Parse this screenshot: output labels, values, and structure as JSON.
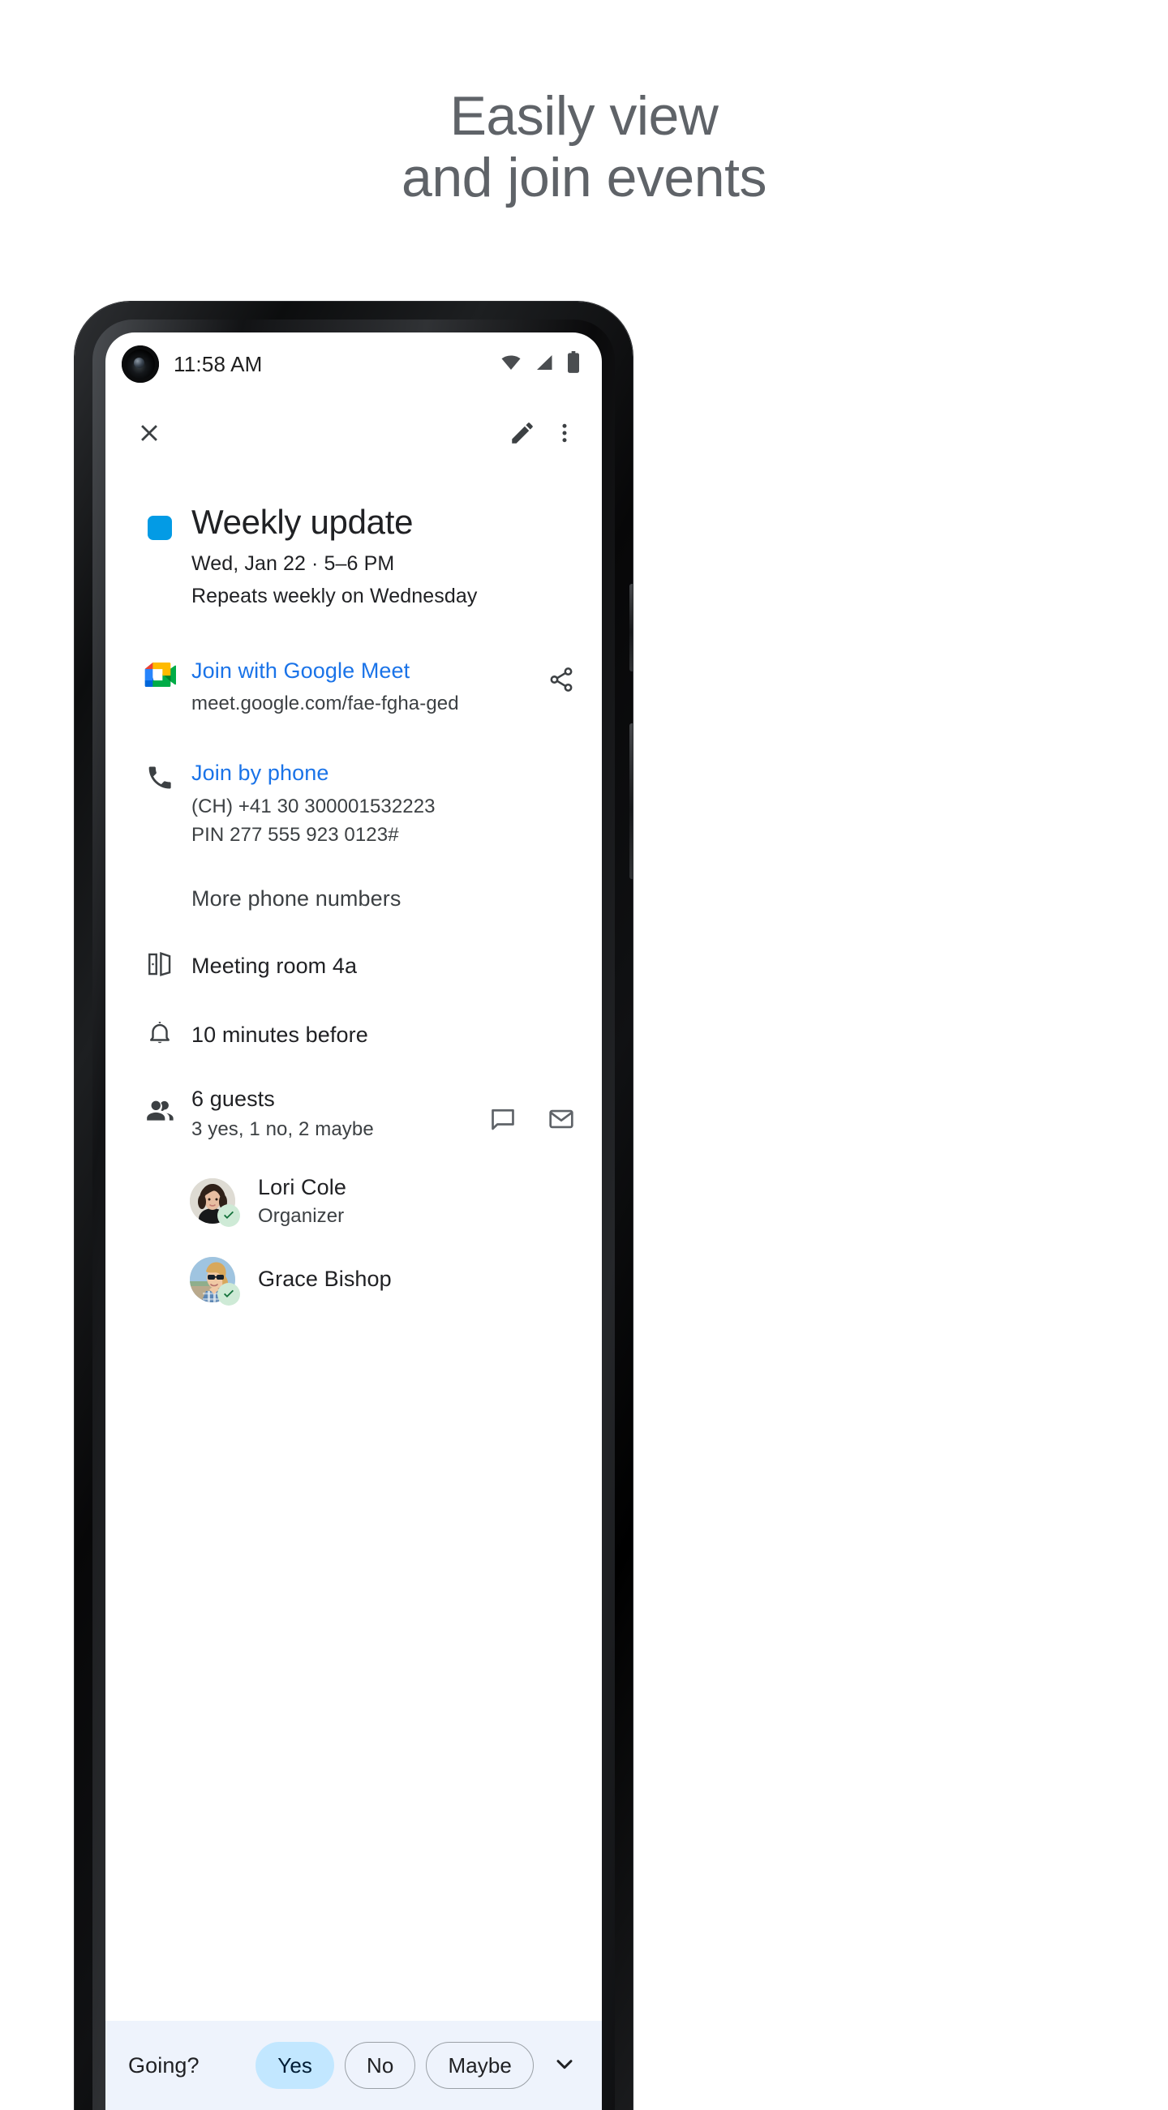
{
  "promo": {
    "headline_line1": "Easily view",
    "headline_line2": "and join events",
    "headline_color": "#5f6368"
  },
  "status_bar": {
    "time": "11:58 AM",
    "icons": [
      "wifi-icon",
      "cellular-signal-icon",
      "battery-icon"
    ]
  },
  "toolbar": {
    "close_label": "Close",
    "edit_label": "Edit",
    "more_label": "More options"
  },
  "event": {
    "color_chip": "#039be5",
    "title": "Weekly update",
    "when": "Wed, Jan 22  ·  5–6 PM",
    "repeat": "Repeats weekly on Wednesday"
  },
  "conferencing": {
    "meet_link_label": "Join with Google Meet",
    "meet_url": "meet.google.com/fae-fgha-ged",
    "share_label": "Share",
    "phone_link_label": "Join by phone",
    "phone_number": "(CH) +41 30 300001532223",
    "phone_pin": "PIN 277 555 923 0123#",
    "more_numbers": "More phone numbers"
  },
  "details": {
    "room": "Meeting room 4a",
    "notification": "10 minutes before"
  },
  "guests": {
    "count_label": "6 guests",
    "rsvp_summary": "3 yes, 1 no, 2 maybe",
    "chat_label": "Message guests",
    "email_label": "Email guests",
    "list": [
      {
        "name": "Lori Cole",
        "role": "Organizer",
        "rsvp": "yes"
      },
      {
        "name": "Grace Bishop",
        "role": "",
        "rsvp": "yes"
      }
    ]
  },
  "rsvp_bar": {
    "question": "Going?",
    "options": [
      {
        "label": "Yes",
        "selected": true
      },
      {
        "label": "No",
        "selected": false
      },
      {
        "label": "Maybe",
        "selected": false
      }
    ],
    "selected_bg": "#c2e7ff",
    "bar_bg": "#eef3fc",
    "expand_label": "Expand"
  },
  "colors": {
    "link_blue": "#1a73e8",
    "text_primary": "#202124",
    "text_secondary": "#3c4043",
    "rsvp_yes_badge": "#ceead6"
  }
}
